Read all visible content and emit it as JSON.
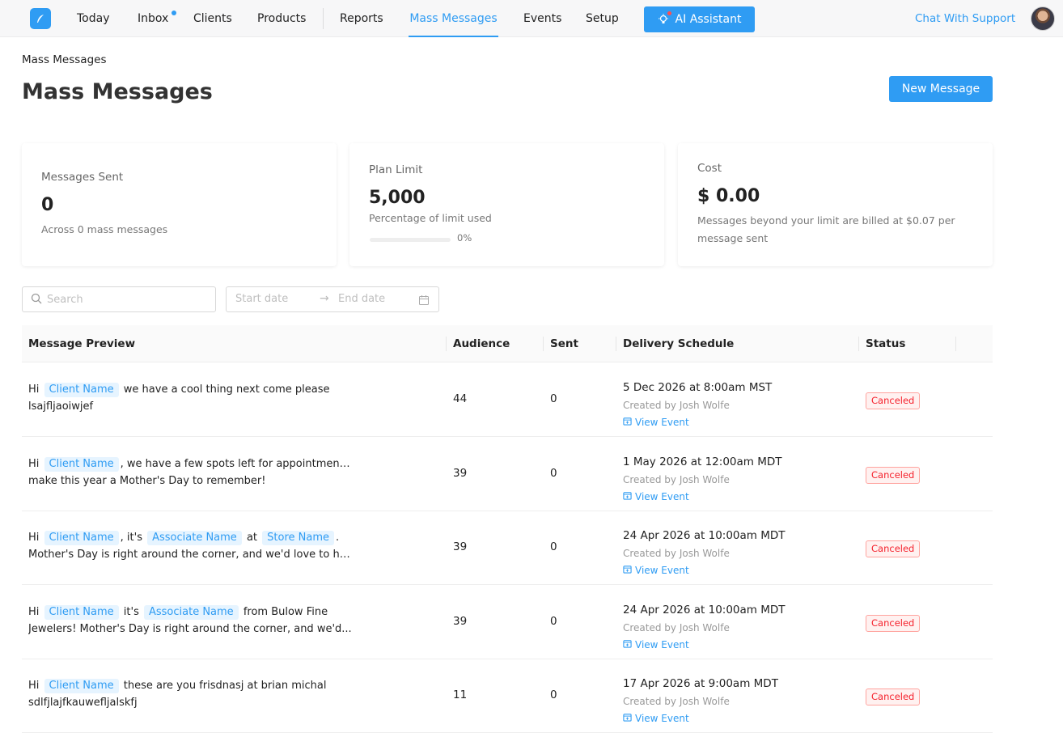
{
  "nav": {
    "items": [
      {
        "label": "Today"
      },
      {
        "label": "Inbox"
      },
      {
        "label": "Clients"
      },
      {
        "label": "Products"
      },
      {
        "label": "Reports"
      },
      {
        "label": "Mass Messages"
      },
      {
        "label": "Events"
      },
      {
        "label": "Setup"
      }
    ],
    "active": "Mass Messages",
    "ai_button": "AI Assistant",
    "support": "Chat With Support"
  },
  "breadcrumb": "Mass Messages",
  "page_title": "Mass Messages",
  "new_button": "New Message",
  "cards": {
    "sent": {
      "label": "Messages Sent",
      "value": "0",
      "sub": "Across 0 mass messages"
    },
    "limit": {
      "label": "Plan Limit",
      "value": "5,000",
      "sub": "Percentage of limit used",
      "percent_text": "0%",
      "progress": 0
    },
    "cost": {
      "label": "Cost",
      "value": "$ 0.00",
      "sub": "Messages beyond your limit are billed at $0.07 per message sent"
    }
  },
  "filters": {
    "search_placeholder": "Search",
    "start_placeholder": "Start date",
    "end_placeholder": "End date"
  },
  "table": {
    "headers": {
      "preview": "Message Preview",
      "audience": "Audience",
      "sent": "Sent",
      "schedule": "Delivery Schedule",
      "status": "Status"
    },
    "rows": [
      {
        "l1": [
          {
            "t": "Hi "
          },
          {
            "tag": "Client Name"
          },
          {
            "t": " we have a cool thing next come please"
          }
        ],
        "l2": "lsajfljaoiwjef",
        "audience": "44",
        "sent": "0",
        "date": "5 Dec 2026 at 8:00am MST",
        "by": "Created by Josh Wolfe",
        "link": "View Event",
        "status": "Canceled"
      },
      {
        "l1": [
          {
            "t": "Hi "
          },
          {
            "tag": "Client Name"
          },
          {
            "t": ", we have a few spots left for appointments,"
          }
        ],
        "l2": "make this year a Mother's Day to remember!",
        "audience": "39",
        "sent": "0",
        "date": "1 May 2026 at 12:00am MDT",
        "by": "Created by Josh Wolfe",
        "link": "View Event",
        "status": "Canceled"
      },
      {
        "l1": [
          {
            "t": "Hi "
          },
          {
            "tag": "Client Name"
          },
          {
            "t": ", it's "
          },
          {
            "tag": "Associate Name"
          },
          {
            "t": " at "
          },
          {
            "tag": "Store Name"
          },
          {
            "t": "."
          }
        ],
        "l2": "Mother's Day is right around the corner, and we'd love to hel...",
        "audience": "39",
        "sent": "0",
        "date": "24 Apr 2026 at 10:00am MDT",
        "by": "Created by Josh Wolfe",
        "link": "View Event",
        "status": "Canceled"
      },
      {
        "l1": [
          {
            "t": "Hi "
          },
          {
            "tag": "Client Name"
          },
          {
            "t": " it's "
          },
          {
            "tag": "Associate Name"
          },
          {
            "t": " from Bulow Fine"
          }
        ],
        "l2": "Jewelers! Mother's Day is right around the corner, and we'd...",
        "audience": "39",
        "sent": "0",
        "date": "24 Apr 2026 at 10:00am MDT",
        "by": "Created by Josh Wolfe",
        "link": "View Event",
        "status": "Canceled"
      },
      {
        "l1": [
          {
            "t": "Hi "
          },
          {
            "tag": "Client Name"
          },
          {
            "t": " these are you frisdnasj at brian michal"
          }
        ],
        "l2": "sdlfjlajfkauwefljalskfj",
        "audience": "11",
        "sent": "0",
        "date": "17 Apr 2026 at 9:00am MDT",
        "by": "Created by Josh Wolfe",
        "link": "View Event",
        "status": "Canceled"
      }
    ]
  },
  "colors": {
    "accent": "#2f9cf3",
    "canceled": "#f5222d"
  },
  "icons": [
    "feather-logo-icon",
    "lightbulb-icon",
    "search-icon",
    "arrow-right-icon",
    "calendar-icon",
    "calendar-event-icon"
  ]
}
